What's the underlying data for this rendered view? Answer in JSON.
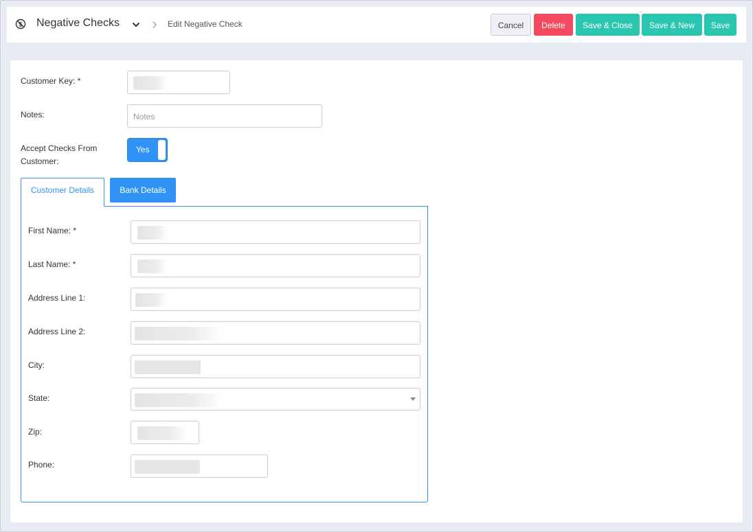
{
  "header": {
    "module_title": "Negative Checks",
    "breadcrumb": "Edit Negative Check",
    "buttons": {
      "cancel": "Cancel",
      "delete": "Delete",
      "save_close": "Save & Close",
      "save_new": "Save & New",
      "save": "Save"
    }
  },
  "form": {
    "customer_key_label": "Customer Key: *",
    "notes_label": "Notes:",
    "notes_placeholder": "Notes",
    "accept_label_line1": "Accept Checks From",
    "accept_label_line2": "Customer:",
    "accept_value": "Yes"
  },
  "tabs": {
    "customer": "Customer Details",
    "bank": "Bank Details"
  },
  "customer_details": {
    "first_name_label": "First Name: *",
    "last_name_label": "Last Name: *",
    "address1_label": "Address Line 1:",
    "address2_label": "Address Line 2:",
    "city_label": "City:",
    "state_label": "State:",
    "zip_label": "Zip:",
    "phone_label": "Phone:"
  },
  "icons": {
    "module": "no-dollar-icon",
    "title_dropdown": "chevron-down-icon",
    "breadcrumb_separator": "chevron-right-icon",
    "state_dropdown": "caret-down-icon"
  },
  "colors": {
    "primary": "#3293f7",
    "danger": "#f34a5f",
    "success": "#2bc6b0"
  }
}
